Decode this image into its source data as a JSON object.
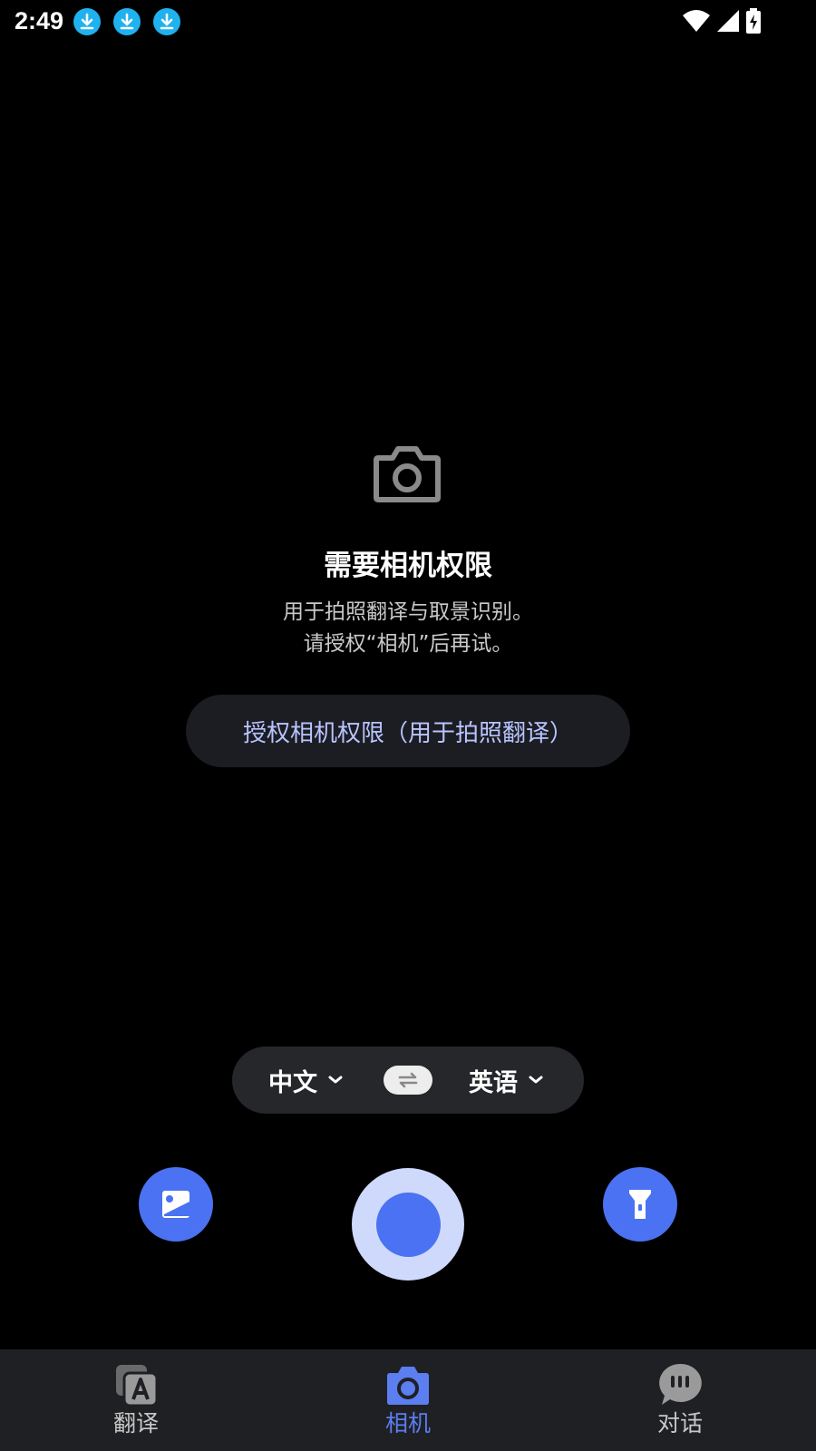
{
  "status_bar": {
    "time": "2:49",
    "notification_icons": [
      "download-icon",
      "download-icon",
      "download-icon"
    ],
    "system_icons": [
      "wifi-icon",
      "signal-icon",
      "battery-charging-icon"
    ]
  },
  "permission": {
    "icon": "camera-icon",
    "title": "需要相机权限",
    "desc_line1": "用于拍照翻译与取景识别。",
    "desc_line2": "请授权“相机”后再试。",
    "button_label": "授权相机权限（用于拍照翻译）"
  },
  "language": {
    "source": "中文",
    "target": "英语",
    "swap_icon": "swap-icon"
  },
  "controls": {
    "gallery_icon": "image-icon",
    "shutter_icon": "shutter-icon",
    "flash_icon": "flashlight-icon"
  },
  "nav": {
    "items": [
      {
        "label": "翻译",
        "icon": "translate-icon",
        "active": false
      },
      {
        "label": "相机",
        "icon": "camera-icon",
        "active": true
      },
      {
        "label": "对话",
        "icon": "chat-icon",
        "active": false
      }
    ]
  },
  "colors": {
    "accent": "#4a72f2",
    "shutter_ring": "#cfd9fb",
    "nav_active": "#5b7ef0",
    "download_badge": "#1fb2ee",
    "button_text": "#b8c4ff"
  }
}
